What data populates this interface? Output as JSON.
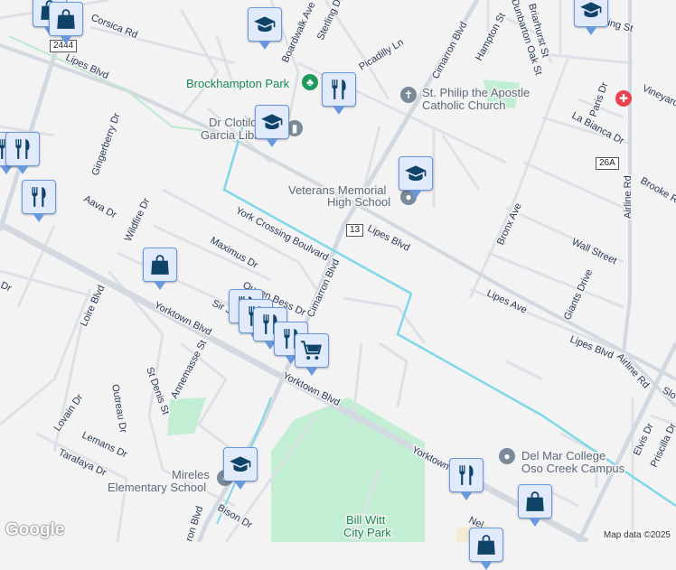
{
  "colors": {
    "road": "#d6dce4",
    "creek": "#7fd8e8",
    "park": "#c2efd3",
    "bg": "#f4f3f4",
    "marker": "#0f4468",
    "hospital": "#e8414f"
  },
  "shields": {
    "s2444": "2444",
    "s13": "13",
    "s26a": "26A"
  },
  "streets": {
    "corsica": "Corsica Rd",
    "boardwalk": "Boardwalk Ave",
    "sterling": "Sterling Dr",
    "picadilly": "Picadilly Ln",
    "cimarron1": "Cimarron Blvd",
    "hampton": "Hampton St",
    "dunbarton": "Dunbarton Oak St",
    "briarhurst": "Briarhurst St",
    "ingst": "ing St",
    "lipes1": "Lipes Blvd",
    "paris": "Paris Dr",
    "vineyard": "Vineyard",
    "labianca": "La Bianca Dr",
    "brooke": "Brooke Rd",
    "airline1": "Airline Rd",
    "gingerberry": "Gingerberry Dr",
    "lipes2": "Lipes Blvd",
    "bronx": "Bronx Ave",
    "wall": "Wall Street",
    "aava": "Aava Dr",
    "wildfire": "Wildfire Dr",
    "york": "York Crossing Boulvard",
    "maximus": "Maximus Dr",
    "lipesave": "Lipes Ave",
    "giants": "Giants Drive",
    "lipes3": "Lipes Blvd",
    "airline2": "Airline Rd",
    "slo": "Slo",
    "queenbess": "Queen Bess Dr",
    "sirj": "Sir J",
    "cimarron2": "Cimarron Blvd",
    "loire": "Loire Blvd",
    "yorktown1": "Yorktown Blvd",
    "yorktown2": "Yorktown Blvd",
    "yorktown3": "Yorktown",
    "annemasse": "Annemasse St",
    "stdenis": "St Denis St",
    "outreau": "Outreau Dr",
    "lovain": "Lovain Dr",
    "lemans": "Lemans Dr",
    "tarafaya": "Tarafaya Dr",
    "bison": "Bison Dr",
    "cimarron3": "ron Blvd",
    "elvis": "Elvis Dr",
    "priscilla": "Priscilla Dr",
    "nel": "Nel",
    "dr": "Dr"
  },
  "places": {
    "brockhampton": "Brockhampton Park",
    "church1": "St. Philip the Apostle",
    "church2": "Catholic Church",
    "library1": "Dr Clotilde",
    "library2": "Garcia Library",
    "veterans1": "Veterans Memorial",
    "veterans2": "High School",
    "mireles1": "Mireles",
    "mireles2": "Elementary School",
    "billwitt1": "Bill Witt",
    "billwitt2": "City Park",
    "delmar1": "Del Mar College",
    "delmar2": "Oso Creek Campus"
  },
  "footer": {
    "credit": "Map data ©2025",
    "logo": "Google"
  }
}
